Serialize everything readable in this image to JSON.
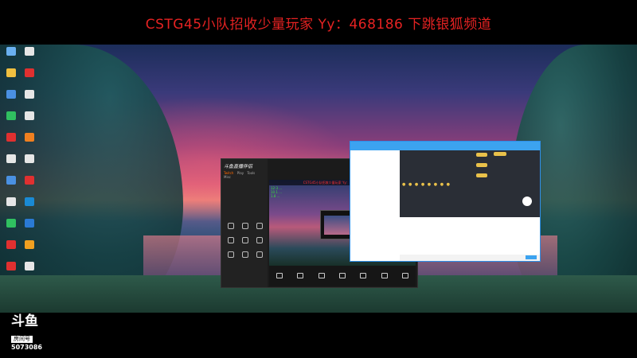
{
  "banner": {
    "text": "CSTG45小队招收少量玩家 Yy：468186 下跳银狐频道"
  },
  "desktop": {
    "icons": [
      {
        "icon": "computer-icon",
        "color": "#6ab0f0"
      },
      {
        "icon": "app-icon",
        "color": "#e6e6e6"
      },
      {
        "icon": "folder-icon",
        "color": "#f0c040"
      },
      {
        "icon": "app-icon",
        "color": "#e03030"
      },
      {
        "icon": "app-icon",
        "color": "#4a90e2"
      },
      {
        "icon": "app-icon",
        "color": "#e6e6e6"
      },
      {
        "icon": "app-icon",
        "color": "#30c060"
      },
      {
        "icon": "app-icon",
        "color": "#e6e6e6"
      },
      {
        "icon": "app-icon",
        "color": "#e03030"
      },
      {
        "icon": "app-icon",
        "color": "#f08020"
      },
      {
        "icon": "app-icon",
        "color": "#e6e6e6"
      },
      {
        "icon": "app-icon",
        "color": "#e6e6e6"
      },
      {
        "icon": "app-icon",
        "color": "#4a90e2"
      },
      {
        "icon": "app-icon",
        "color": "#e03030"
      },
      {
        "icon": "app-icon",
        "color": "#e6e6e6"
      },
      {
        "icon": "app-icon",
        "color": "#1a8ad4"
      },
      {
        "icon": "app-icon",
        "color": "#30c060"
      },
      {
        "icon": "app-icon",
        "color": "#2a7ad4"
      },
      {
        "icon": "app-icon",
        "color": "#e03030"
      },
      {
        "icon": "app-icon",
        "color": "#f0a020"
      },
      {
        "icon": "app-icon",
        "color": "#e03030"
      },
      {
        "icon": "app-icon",
        "color": "#e6e6e6"
      }
    ]
  },
  "player": {
    "brand": "斗鱼直播伴侣",
    "tabs": [
      "Twitch",
      "Play",
      "Tools",
      "Misc"
    ],
    "ticker": "CSTG45小队招收少量玩家 Yy：468186 下跳银狐频道",
    "green_rows": [
      "12:3 ...",
      "10.1 ...",
      "1.8 ..."
    ]
  },
  "chat": {
    "coins": "● ● ● ● ● ● ● ●"
  },
  "footer": {
    "logo": "斗鱼",
    "sub": "房间号",
    "room_number": "5073086"
  }
}
